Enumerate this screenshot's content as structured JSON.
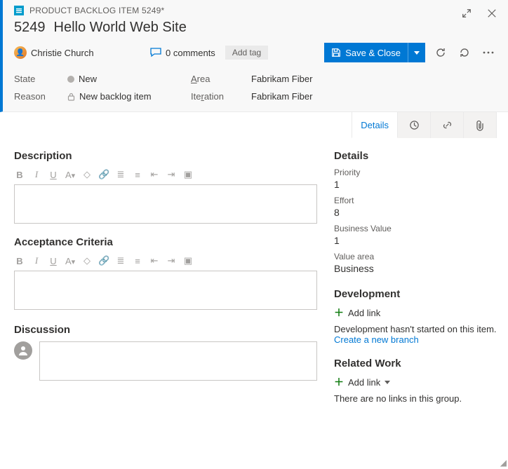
{
  "header": {
    "breadcrumb": "PRODUCT BACKLOG ITEM 5249*",
    "id": "5249",
    "title": "Hello World Web Site",
    "assignee": "Christie Church",
    "comments_label": "0 comments",
    "add_tag_label": "Add tag",
    "save_label": "Save & Close"
  },
  "fields": {
    "state_label": "State",
    "state_value": "New",
    "area_label_pre": "A",
    "area_label_post": "rea",
    "area_value": "Fabrikam Fiber",
    "reason_label": "Reason",
    "reason_value": "New backlog item",
    "iteration_label_pre": "Ite",
    "iteration_label_post": "ation",
    "iteration_label_u": "r",
    "iteration_value": "Fabrikam Fiber"
  },
  "tabs": {
    "details": "Details"
  },
  "left": {
    "description": "Description",
    "acceptance": "Acceptance Criteria",
    "discussion": "Discussion"
  },
  "right": {
    "details_header": "Details",
    "priority_label": "Priority",
    "priority_value": "1",
    "effort_label": "Effort",
    "effort_value": "8",
    "bv_label": "Business Value",
    "bv_value": "1",
    "va_label": "Value area",
    "va_value": "Business",
    "development_header": "Development",
    "add_link": "Add link",
    "dev_hint": "Development hasn't started on this item.",
    "create_branch": "Create a new branch",
    "related_header": "Related Work",
    "related_hint": "There are no links in this group."
  }
}
